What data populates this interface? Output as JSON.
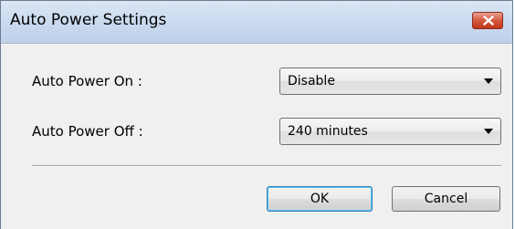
{
  "dialog": {
    "title": "Auto Power Settings",
    "close_icon": "close-icon"
  },
  "fields": [
    {
      "label": "Auto Power On :",
      "value": "Disable"
    },
    {
      "label": "Auto Power Off :",
      "value": "240 minutes"
    }
  ],
  "buttons": {
    "ok": "OK",
    "cancel": "Cancel"
  },
  "colors": {
    "titlebar": "#c9d9ee",
    "close_button": "#d5573e",
    "default_button_border": "#3c7fb1",
    "dialog_background": "#f0f0f0"
  }
}
